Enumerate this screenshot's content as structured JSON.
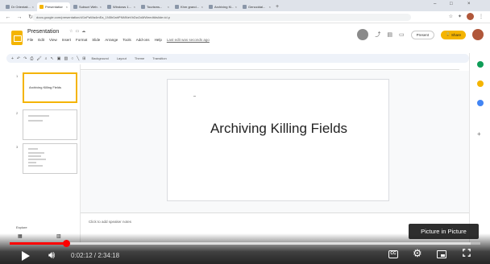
{
  "browser": {
    "tabs": [
      {
        "title": "Dr Orientati...",
        "favicon": "generic-favicon"
      },
      {
        "title": "Presentation",
        "favicon": "slides-favicon",
        "active": true
      },
      {
        "title": "Subscri Web...",
        "favicon": "generic-favicon"
      },
      {
        "title": "Windows 1...",
        "favicon": "generic-favicon"
      },
      {
        "title": "Tourisms...",
        "favicon": "generic-favicon"
      },
      {
        "title": "Khm grand...",
        "favicon": "generic-favicon"
      },
      {
        "title": "Archiving Ki...",
        "favicon": "generic-favicon"
      },
      {
        "title": "Genocidal...",
        "favicon": "generic-favicon"
      }
    ],
    "new_tab_symbol": "+",
    "window_controls": [
      "–",
      "□",
      "×"
    ],
    "url": "docs.google.com/presentation/d/1nPaWa4mEa_1N5h0ahPNMNeVbDw2oMWeedit#slide=id.p"
  },
  "slides_app": {
    "doc_title": "Presentation",
    "menu": [
      "File",
      "Edit",
      "View",
      "Insert",
      "Format",
      "Slide",
      "Arrange",
      "Tools",
      "Add-ons",
      "Help",
      "Last edit was seconds ago"
    ],
    "present_label": "Present",
    "share_label": "Share",
    "toolbar_text": [
      "Background",
      "Layout",
      "Theme",
      "Transition"
    ],
    "thumbnails": [
      {
        "number": "1",
        "title": "Archiving Killing Fields"
      },
      {
        "number": "2",
        "title": ""
      },
      {
        "number": "3",
        "title": ""
      }
    ],
    "slide_title": "Archiving Killing Fields",
    "speaker_notes_placeholder": "Click to add speaker notes",
    "view_label": "Explore"
  },
  "player": {
    "time_display": "0:02:12 / 2:34:18",
    "progress_fraction": 0.12,
    "buffered_fraction": 0.98,
    "pip_tooltip": "Picture in Picture",
    "cc_label": "CC",
    "accent_color": "#ff0000"
  },
  "colors": {
    "slides_yellow": "#f4b400",
    "toolbar_bg": "#eef2f9"
  }
}
